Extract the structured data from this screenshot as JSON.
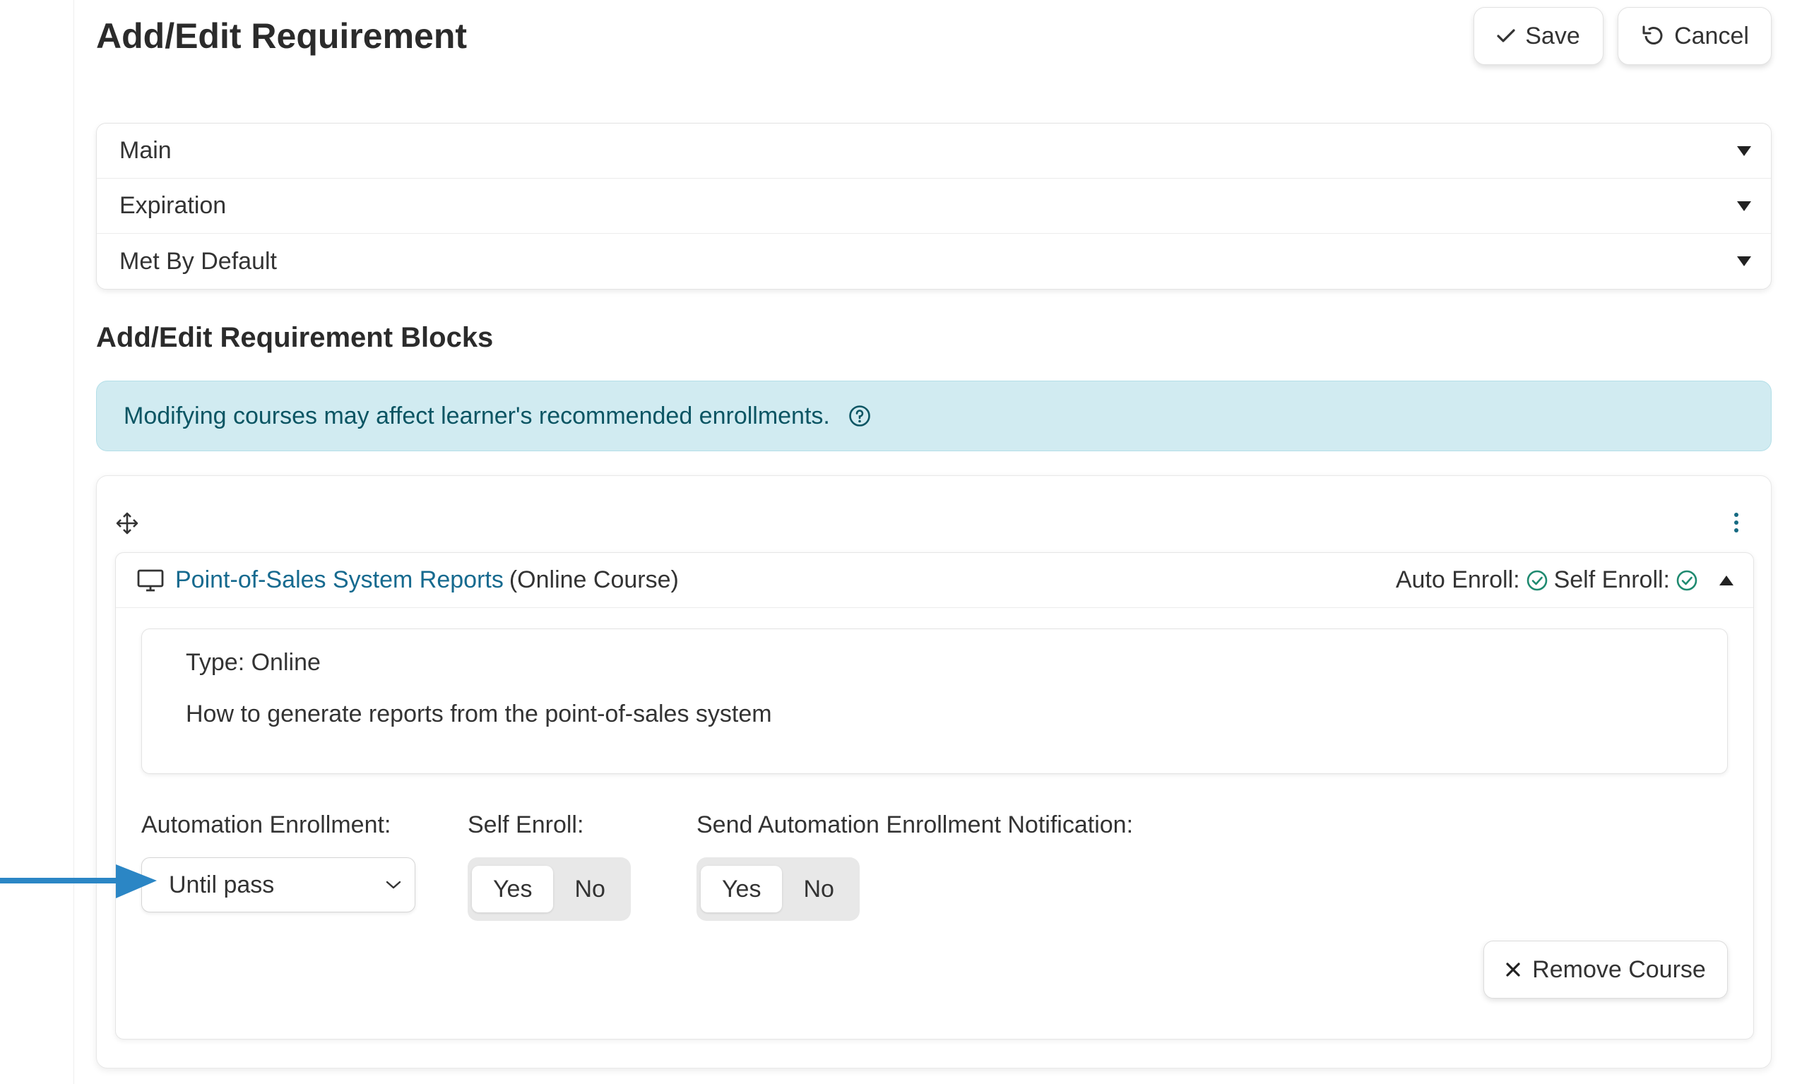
{
  "page": {
    "title": "Add/Edit Requirement",
    "save_label": "Save",
    "cancel_label": "Cancel"
  },
  "accordion": {
    "items": [
      {
        "label": "Main"
      },
      {
        "label": "Expiration"
      },
      {
        "label": "Met By Default"
      }
    ]
  },
  "blocks": {
    "section_title": "Add/Edit Requirement Blocks",
    "alert_text": "Modifying courses may affect learner's recommended enrollments."
  },
  "course": {
    "name": "Point-of-Sales System Reports",
    "type_label": "(Online Course)",
    "auto_enroll_label": "Auto Enroll:",
    "self_enroll_label": "Self Enroll:",
    "type_line": "Type: Online",
    "description": "How to generate reports from the point-of-sales system",
    "automation_enrollment_label": "Automation Enrollment:",
    "automation_enrollment_value": "Until pass",
    "self_enroll_field_label": "Self Enroll:",
    "send_notification_label": "Send Automation Enrollment Notification:",
    "yes_label": "Yes",
    "no_label": "No",
    "remove_label": "Remove Course"
  },
  "colors": {
    "link": "#166a8f",
    "alert_bg": "#d1ebf1",
    "alert_text": "#0b5563",
    "check": "#1f8a70",
    "annotation_arrow": "#2b86c5"
  }
}
